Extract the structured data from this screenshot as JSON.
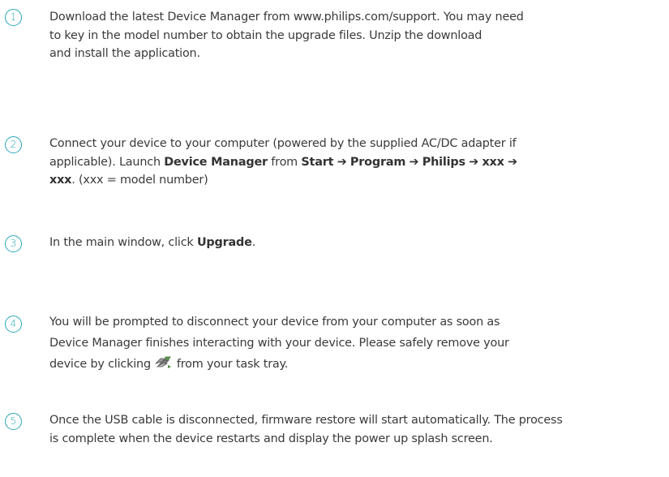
{
  "steps": [
    {
      "number": "1",
      "lines": [
        "Download the latest Device Manager from www.philips.com/support. You may need",
        "to key in the model number to obtain the upgrade files.  Unzip the download",
        "and install the application."
      ]
    },
    {
      "number": "2",
      "line1": "Connect your device to your computer (powered by the supplied AC/DC adapter if",
      "line2_pre": "applicable).  Launch ",
      "device_manager": "Device Manager",
      "from": " from ",
      "start": "Start",
      "arrow": "➔",
      "program": "Program",
      "philips": "Philips",
      "xxx": "xxx",
      "model_note": ".  (xxx = model number)"
    },
    {
      "number": "3",
      "pre": "In the main window, click ",
      "upgrade": "Upgrade",
      "post": "."
    },
    {
      "number": "4",
      "line1": "You will be prompted to disconnect your device from your computer as soon as",
      "line2": "Device Manager finishes interacting with your device.  Please safely remove your",
      "line3_pre": "device by clicking",
      "line3_post": "from your task tray.",
      "icon": "safely-remove-hardware-icon"
    },
    {
      "number": "5",
      "lines": [
        "Once the USB cable is disconnected, firmware restore will start automatically. The process",
        "is complete when the device restarts and display the power up splash screen."
      ]
    }
  ],
  "colors": {
    "accent": "#2aa7b8",
    "text": "#3a3a3a"
  }
}
